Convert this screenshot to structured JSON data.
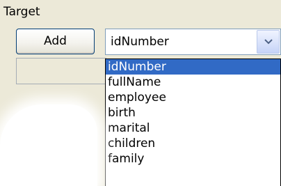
{
  "group": {
    "title": "Target"
  },
  "toolbar": {
    "add_label": "Add"
  },
  "combo": {
    "selected_value": "idNumber",
    "arrow_icon": "chevron-down-icon"
  },
  "dropdown": {
    "items": [
      {
        "label": "idNumber",
        "selected": true
      },
      {
        "label": "fullName",
        "selected": false
      },
      {
        "label": "employee",
        "selected": false
      },
      {
        "label": "birth",
        "selected": false
      },
      {
        "label": "marital",
        "selected": false
      },
      {
        "label": "children",
        "selected": false
      },
      {
        "label": "family",
        "selected": false
      }
    ]
  },
  "colors": {
    "window_background": "#ece9d8",
    "selection_highlight": "#316ac5",
    "selection_text": "#ffffff",
    "combo_border": "#7f9db9"
  }
}
